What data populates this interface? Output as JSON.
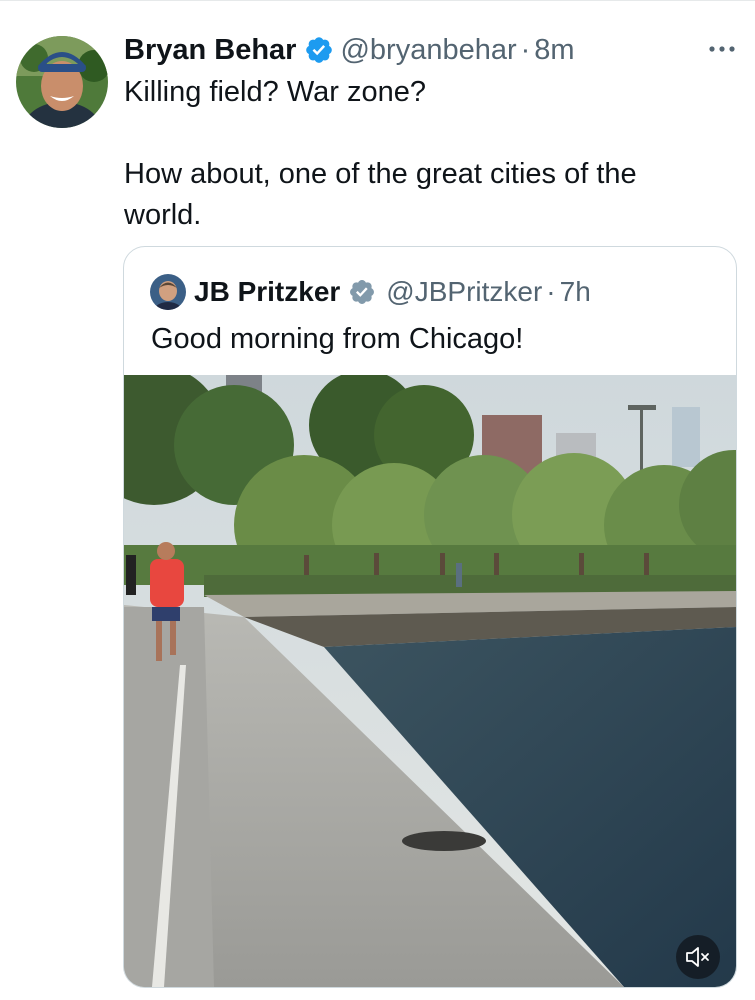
{
  "tweet": {
    "author": {
      "name": "Bryan Behar",
      "handle": "@bryanbehar",
      "separator": "·",
      "time": "8m",
      "verified": true
    },
    "text_line1": "Killing field? War zone?",
    "text_line2": "How about, one of the great cities of the world.",
    "more_icon": "more-horizontal-icon"
  },
  "quote": {
    "author": {
      "name": "JB Pritzker",
      "handle": "@JBPritzker",
      "separator": "·",
      "time": "7h",
      "verified": true
    },
    "text": "Good morning from Chicago!",
    "media": {
      "type": "video",
      "description_icon": "video-thumbnail",
      "muted": true,
      "mute_icon": "speaker-muted-icon"
    }
  },
  "colors": {
    "verified_blue": "#1d9bf0",
    "quote_verified_gray": "#829aab",
    "secondary_text": "#536471",
    "border": "#cfd9de"
  }
}
